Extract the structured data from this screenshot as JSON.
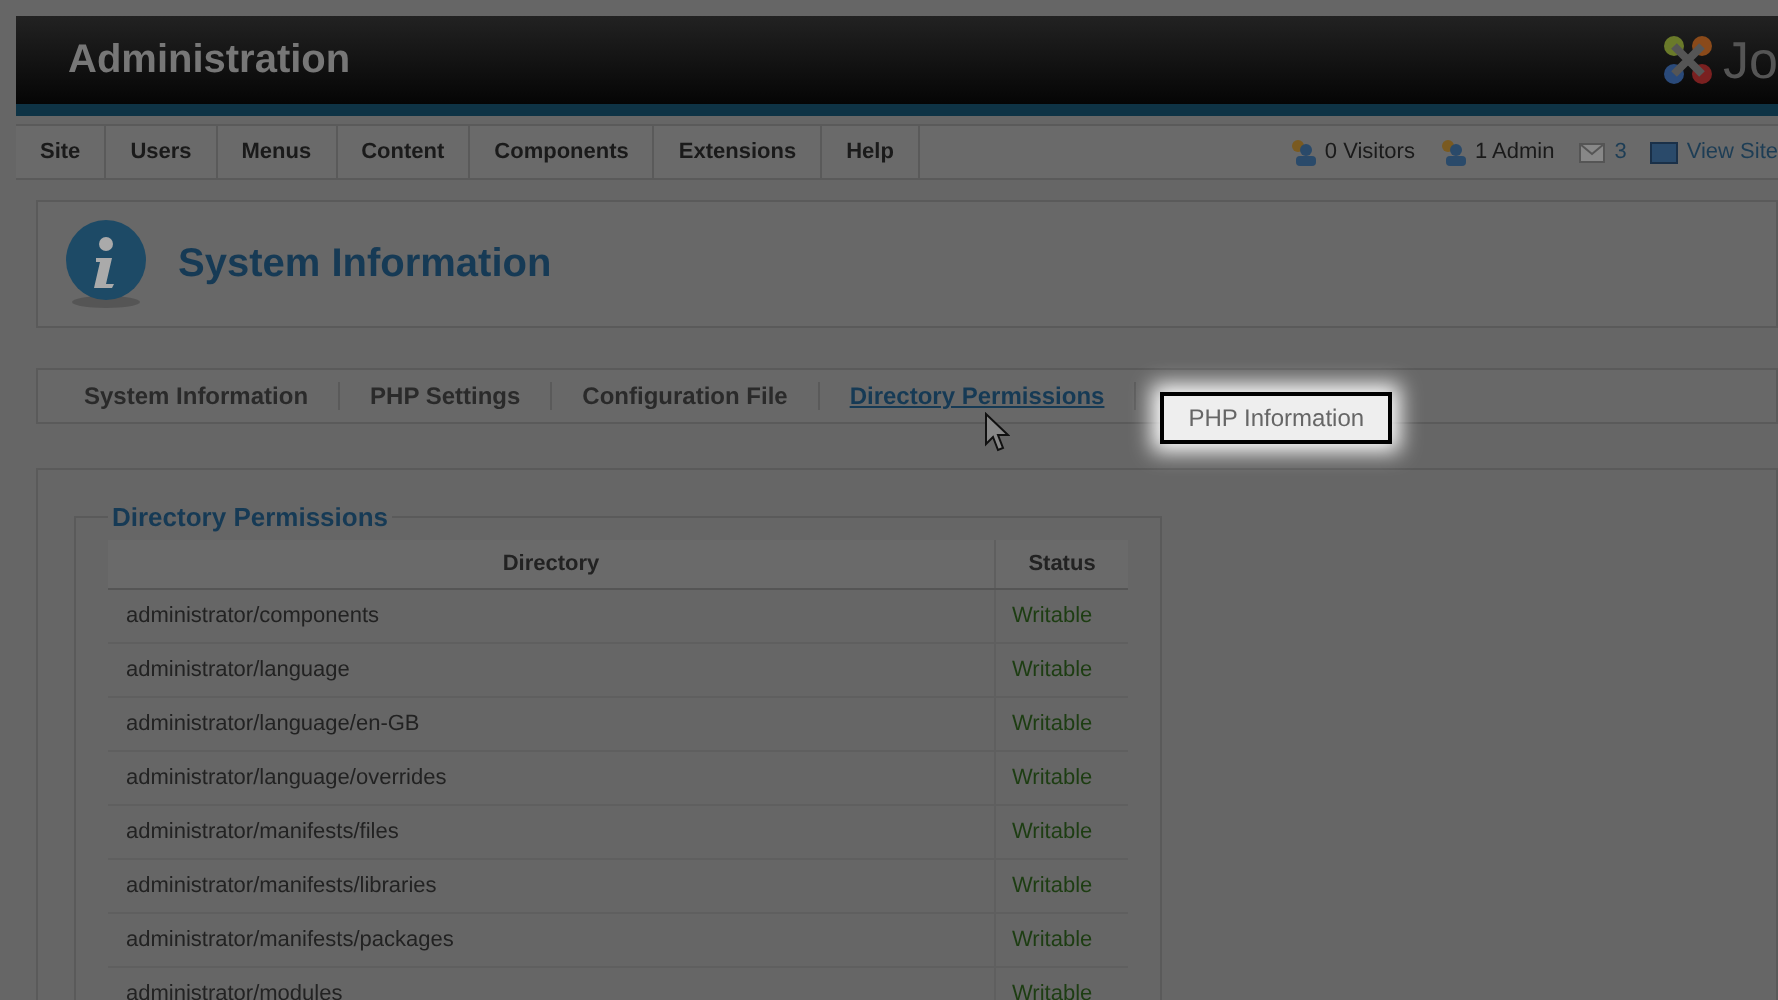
{
  "header": {
    "title": "Administration",
    "logo_text": "Jo"
  },
  "menu": [
    "Site",
    "Users",
    "Menus",
    "Content",
    "Components",
    "Extensions",
    "Help"
  ],
  "status": [
    {
      "kind": "visitors",
      "label": "0 Visitors"
    },
    {
      "kind": "admin",
      "label": "1 Admin"
    },
    {
      "kind": "messages",
      "label": "3"
    },
    {
      "kind": "view",
      "label": "View Site"
    }
  ],
  "toolbar": {
    "title": "System Information"
  },
  "tabs": [
    {
      "label": "System Information",
      "selected": false,
      "highlighted": false
    },
    {
      "label": "PHP Settings",
      "selected": false,
      "highlighted": false
    },
    {
      "label": "Configuration File",
      "selected": false,
      "highlighted": false
    },
    {
      "label": "Directory Permissions",
      "selected": true,
      "highlighted": false
    },
    {
      "label": "PHP Information",
      "selected": false,
      "highlighted": true
    }
  ],
  "panel": {
    "legend": "Directory Permissions",
    "columns": [
      "Directory",
      "Status"
    ],
    "rows": [
      [
        "administrator/components",
        "Writable"
      ],
      [
        "administrator/language",
        "Writable"
      ],
      [
        "administrator/language/en-GB",
        "Writable"
      ],
      [
        "administrator/language/overrides",
        "Writable"
      ],
      [
        "administrator/manifests/files",
        "Writable"
      ],
      [
        "administrator/manifests/libraries",
        "Writable"
      ],
      [
        "administrator/manifests/packages",
        "Writable"
      ],
      [
        "administrator/modules",
        "Writable"
      ]
    ]
  }
}
